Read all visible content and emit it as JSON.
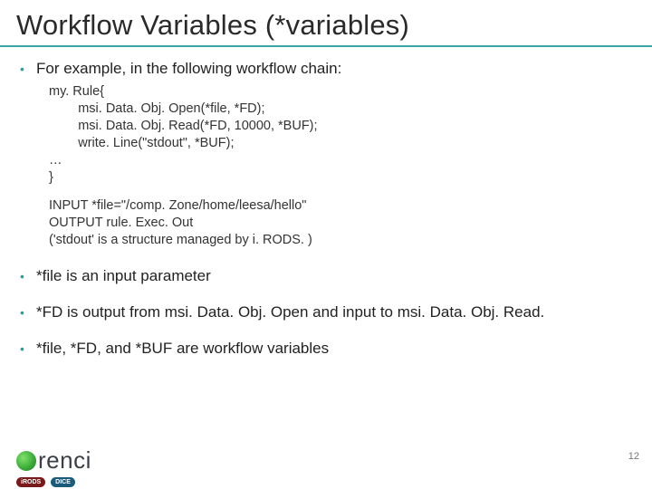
{
  "title": "Workflow Variables (*variables)",
  "intro": "For example, in the following workflow chain:",
  "code": {
    "l1": "my. Rule{",
    "l2": "        msi. Data. Obj. Open(*file, *FD);",
    "l3": "        msi. Data. Obj. Read(*FD, 10000, *BUF);",
    "l4": "        write. Line(\"stdout\", *BUF);",
    "l5": "…",
    "l6": "}"
  },
  "io": {
    "input": "INPUT *file=\"/comp. Zone/home/leesa/hello\"",
    "output": "OUTPUT rule. Exec. Out",
    "note": "('stdout' is a structure managed by i. RODS. )"
  },
  "bullets": {
    "b1": "*file is an input parameter",
    "b2": "*FD is output from msi. Data. Obj. Open and input to msi. Data. Obj. Read.",
    "b3": "*file, *FD, and *BUF are workflow variables"
  },
  "footer": {
    "page": "12",
    "renci": "renci",
    "badge_irods": "iRODS",
    "badge_dice": "DICE"
  }
}
